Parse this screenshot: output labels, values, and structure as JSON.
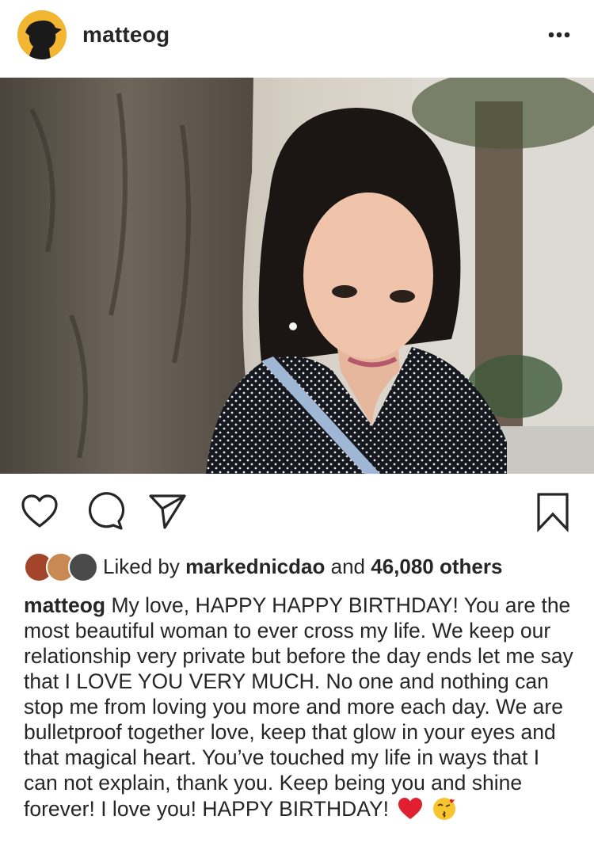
{
  "post": {
    "username": "matteog",
    "likes": {
      "prefix": "Liked by",
      "liker": "markednicdao",
      "and": "and",
      "count": "46,080 others"
    },
    "caption": {
      "username": "matteog",
      "text": "My love, HAPPY HAPPY BIRTHDAY! You are the most beautiful woman to ever cross my life. We keep our relationship very private but before the day ends let me say that I LOVE YOU VERY MUCH. No one and nothing can stop me from loving you more and more each day. We are bulletproof together love, keep that glow in your eyes and that magical heart. You’ve touched my life in ways that I can not explain, thank you. Keep being you and shine forever! I love you! HAPPY BIRTHDAY!"
    }
  },
  "icons": {
    "avatar": "avatar-silhouette",
    "more": "more-dots-icon",
    "like": "heart-icon",
    "comment": "comment-icon",
    "share": "send-icon",
    "save": "bookmark-icon",
    "emoji_1": "red-heart-emoji",
    "emoji_2": "kissing-face-emoji"
  },
  "colors": {
    "text": "#262626",
    "avatar_bg": "#f2b632",
    "heart_emoji": "#e0202e",
    "kiss_emoji": "#f7c52e"
  }
}
